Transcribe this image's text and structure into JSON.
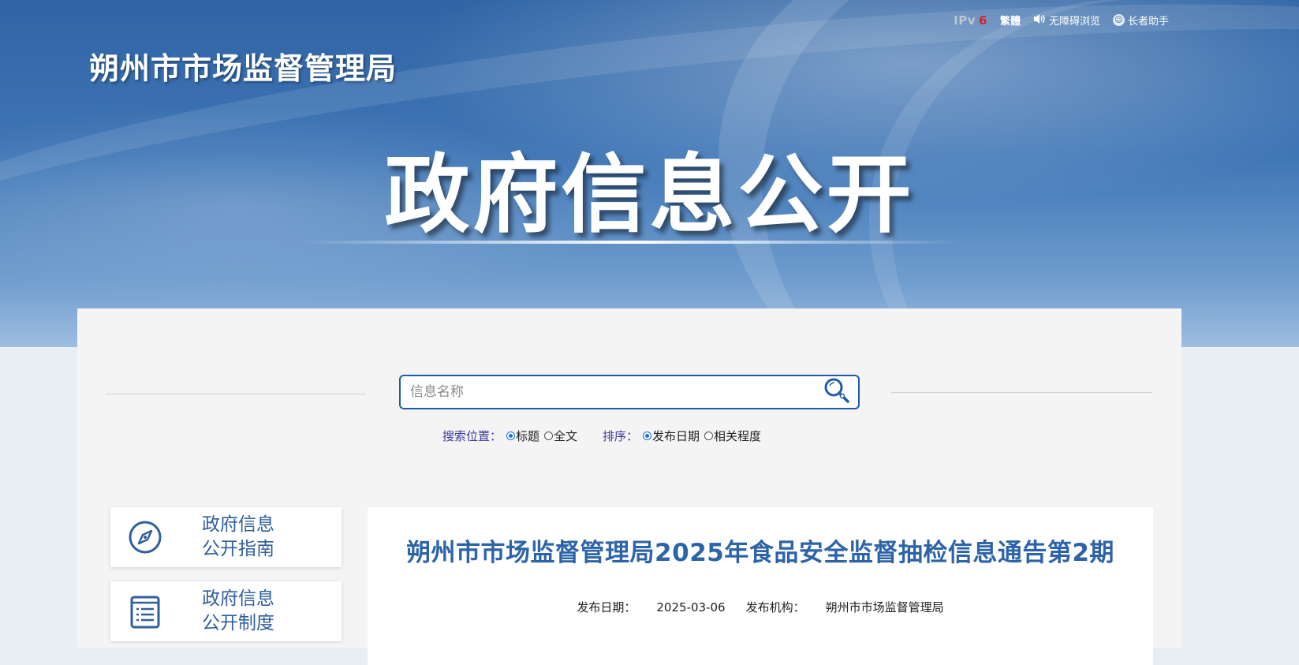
{
  "header": {
    "ipv6_text": "IPv",
    "ipv6_num": "6",
    "traditional": "繁體",
    "accessibility": "无障碍浏览",
    "elder_mode": "长者助手",
    "site_name": "朔州市市场监督管理局",
    "hero_title": "政府信息公开"
  },
  "search": {
    "placeholder": "信息名称",
    "position_label": "搜索位置：",
    "position_options": [
      "标题",
      "全文"
    ],
    "position_selected": "标题",
    "sort_label": "排序：",
    "sort_options": [
      "发布日期",
      "相关程度"
    ],
    "sort_selected": "发布日期"
  },
  "sidebar": {
    "items": [
      {
        "label": "政府信息\n公开指南",
        "icon": "compass-icon"
      },
      {
        "label": "政府信息\n公开制度",
        "icon": "document-list-icon"
      }
    ]
  },
  "article": {
    "title": "朔州市市场监督管理局2025年食品安全监督抽检信息通告第2期",
    "date_label": "发布日期：",
    "date": "2025-03-06",
    "org_label": "发布机构：",
    "org": "朔州市市场监督管理局"
  },
  "colors": {
    "banner_blue": "#2f64a5",
    "title_blue": "#2d64a8",
    "accent_red": "#d9202a"
  }
}
